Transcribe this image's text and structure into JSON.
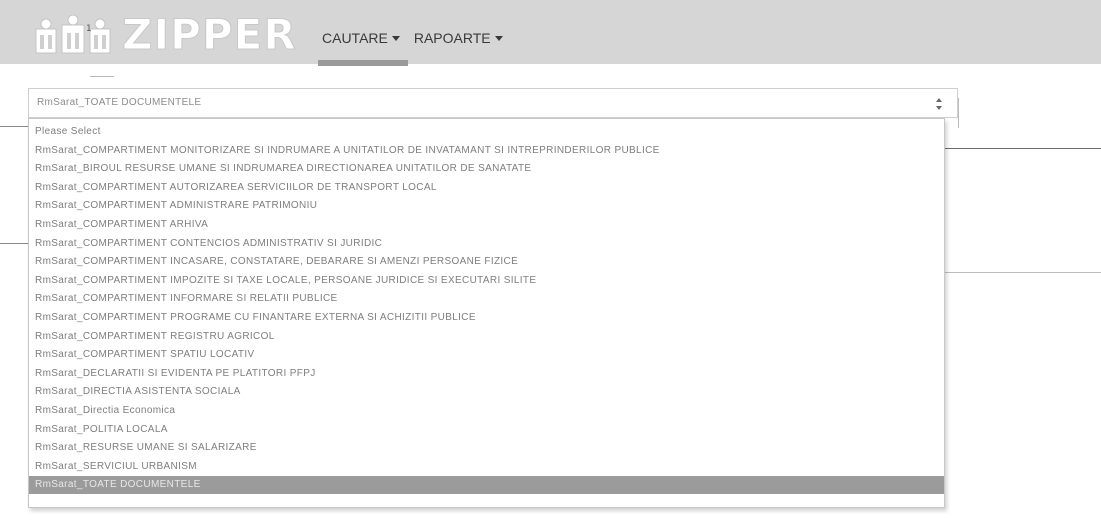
{
  "app": {
    "logo_text": "ZIPPER"
  },
  "nav": {
    "items": [
      {
        "label": "CAUTARE"
      },
      {
        "label": "RAPOARTE"
      }
    ]
  },
  "select": {
    "value": "RmSarat_TOATE DOCUMENTELE",
    "options": [
      "Please Select",
      "RmSarat_COMPARTIMENT MONITORIZARE SI INDRUMARE A UNITATILOR DE INVATAMANT SI INTREPRINDERILOR PUBLICE",
      "RmSarat_BIROUL RESURSE UMANE SI INDRUMAREA DIRECTIONAREA UNITATILOR DE SANATATE",
      "RmSarat_COMPARTIMENT AUTORIZAREA SERVICIILOR DE TRANSPORT LOCAL",
      "RmSarat_COMPARTIMENT ADMINISTRARE PATRIMONIU",
      "RmSarat_COMPARTIMENT ARHIVA",
      "RmSarat_COMPARTIMENT CONTENCIOS ADMINISTRATIV SI JURIDIC",
      "RmSarat_COMPARTIMENT INCASARE, CONSTATARE, DEBARARE SI AMENZI PERSOANE FIZICE",
      "RmSarat_COMPARTIMENT IMPOZITE SI TAXE LOCALE, PERSOANE JURIDICE SI EXECUTARI SILITE",
      "RmSarat_COMPARTIMENT INFORMARE SI RELATII PUBLICE",
      "RmSarat_COMPARTIMENT PROGRAME CU FINANTARE EXTERNA SI ACHIZITII PUBLICE",
      "RmSarat_COMPARTIMENT REGISTRU AGRICOL",
      "RmSarat_COMPARTIMENT SPATIU LOCATIV",
      "RmSarat_DECLARATII SI EVIDENTA PE PLATITORI PFPJ",
      "RmSarat_DIRECTIA ASISTENTA SOCIALA",
      "RmSarat_Directia Economica",
      "RmSarat_POLITIA LOCALA",
      "RmSarat_RESURSE UMANE SI SALARIZARE",
      "RmSarat_SERVICIUL URBANISM",
      "RmSarat_TOATE DOCUMENTELE"
    ],
    "selected_index": 19
  },
  "colors": {
    "navbar_bg": "#d6d6d6",
    "selected_bg": "#9b9b9b",
    "option_text": "#7e7e7e"
  }
}
